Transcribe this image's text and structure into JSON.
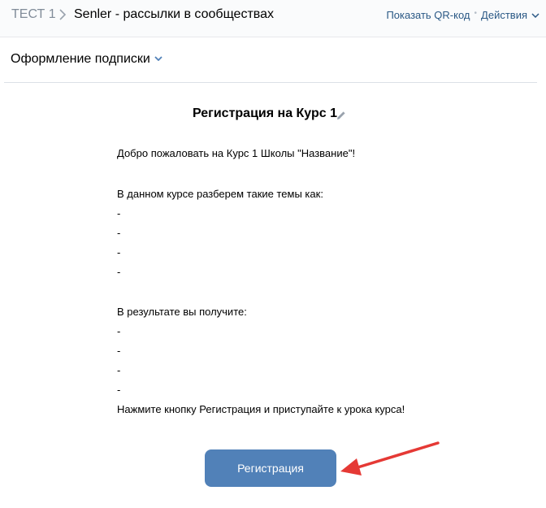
{
  "breadcrumb": {
    "root": "ТЕСТ 1",
    "title": "Senler - рассылки в сообществах"
  },
  "top_actions": {
    "qr_label": "Показать QR-код",
    "actions_label": "Действия"
  },
  "section": {
    "title": "Оформление подписки"
  },
  "form": {
    "title": "Регистрация на Курс 1",
    "lines": [
      "Добро пожаловать на Курс 1 Школы \"Название\"!",
      "В данном курсе разберем такие темы как:",
      "-",
      "-",
      "-",
      "-",
      "В результате вы получите:",
      "-",
      "-",
      "-",
      "-",
      "Нажмите кнопку Регистрация и приступайте к урока курса!"
    ],
    "button_label": "Регистрация"
  },
  "colors": {
    "accent": "#5181b8",
    "link": "#2a5885",
    "annotation_arrow": "#e53935"
  }
}
